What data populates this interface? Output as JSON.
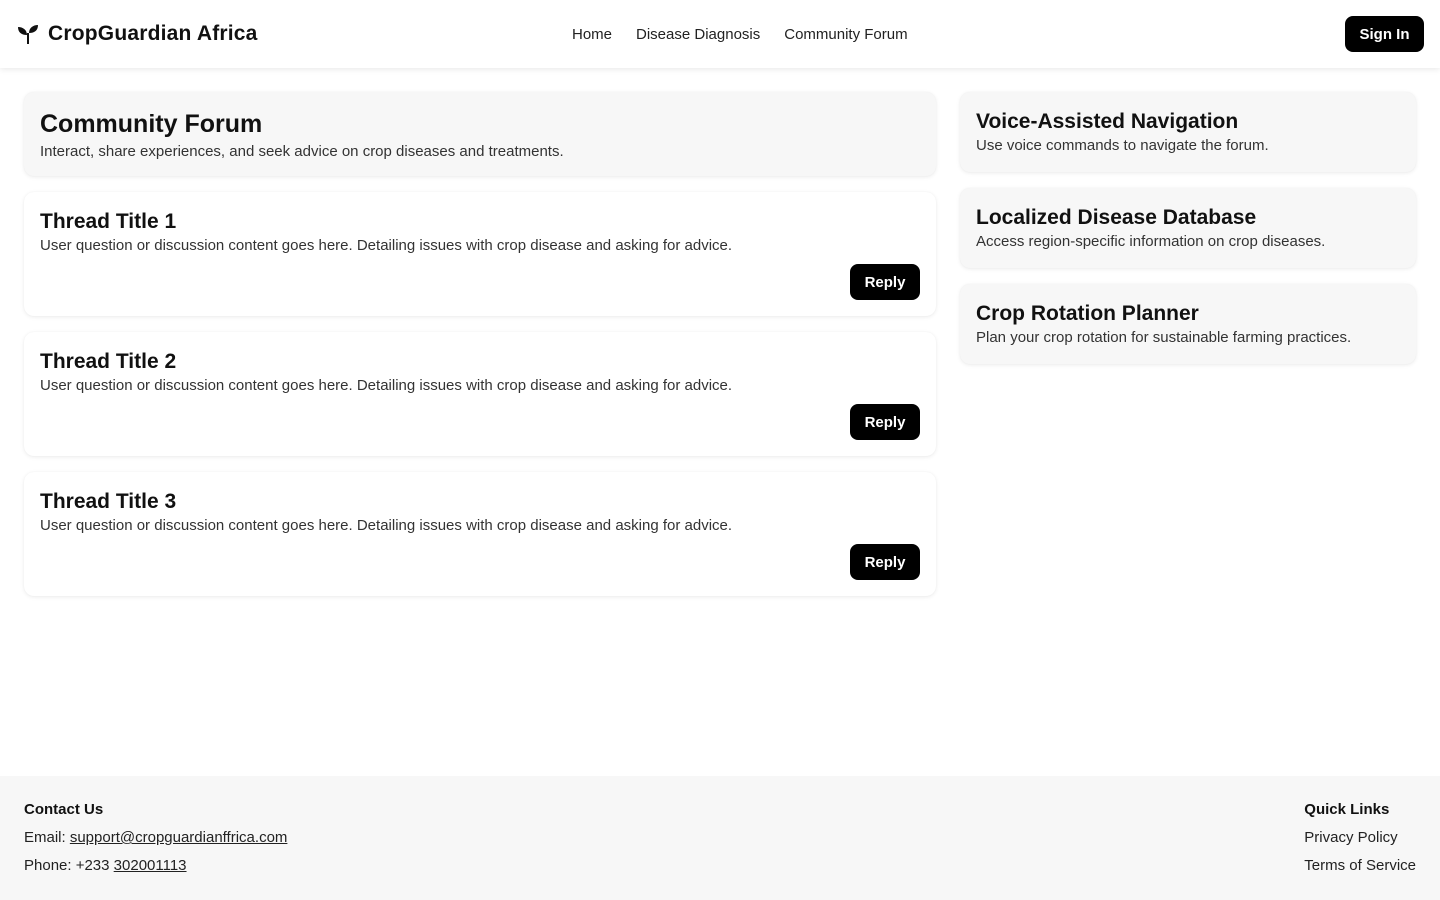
{
  "header": {
    "brand_name": "CropGuardian Africa",
    "brand_icon": "sprout-icon",
    "nav": [
      "Home",
      "Disease Diagnosis",
      "Community Forum"
    ],
    "sign_in_label": "Sign In"
  },
  "forum": {
    "title": "Community Forum",
    "description": "Interact, share experiences, and seek advice on crop diseases and treatments.",
    "threads": [
      {
        "title": "Thread Title 1",
        "body": "User question or discussion content goes here. Detailing issues with crop disease and asking for advice.",
        "reply_label": "Reply"
      },
      {
        "title": "Thread Title 2",
        "body": "User question or discussion content goes here. Detailing issues with crop disease and asking for advice.",
        "reply_label": "Reply"
      },
      {
        "title": "Thread Title 3",
        "body": "User question or discussion content goes here. Detailing issues with crop disease and asking for advice.",
        "reply_label": "Reply"
      }
    ]
  },
  "sidebar": {
    "cards": [
      {
        "title": "Voice-Assisted Navigation",
        "description": "Use voice commands to navigate the forum."
      },
      {
        "title": "Localized Disease Database",
        "description": "Access region-specific information on crop diseases."
      },
      {
        "title": "Crop Rotation Planner",
        "description": "Plan your crop rotation for sustainable farming practices."
      }
    ]
  },
  "footer": {
    "contact_heading": "Contact Us",
    "email_label": "Email: ",
    "email_value": "support@cropguardianffrica.com",
    "phone_label": "Phone: +233 ",
    "phone_value": "302001113",
    "quick_links_heading": "Quick Links",
    "quick_links": [
      "Privacy Policy",
      "Terms of Service"
    ]
  },
  "colors": {
    "accent": "#000000",
    "card_background": "#f7f7f7",
    "page_background": "#ffffff"
  }
}
